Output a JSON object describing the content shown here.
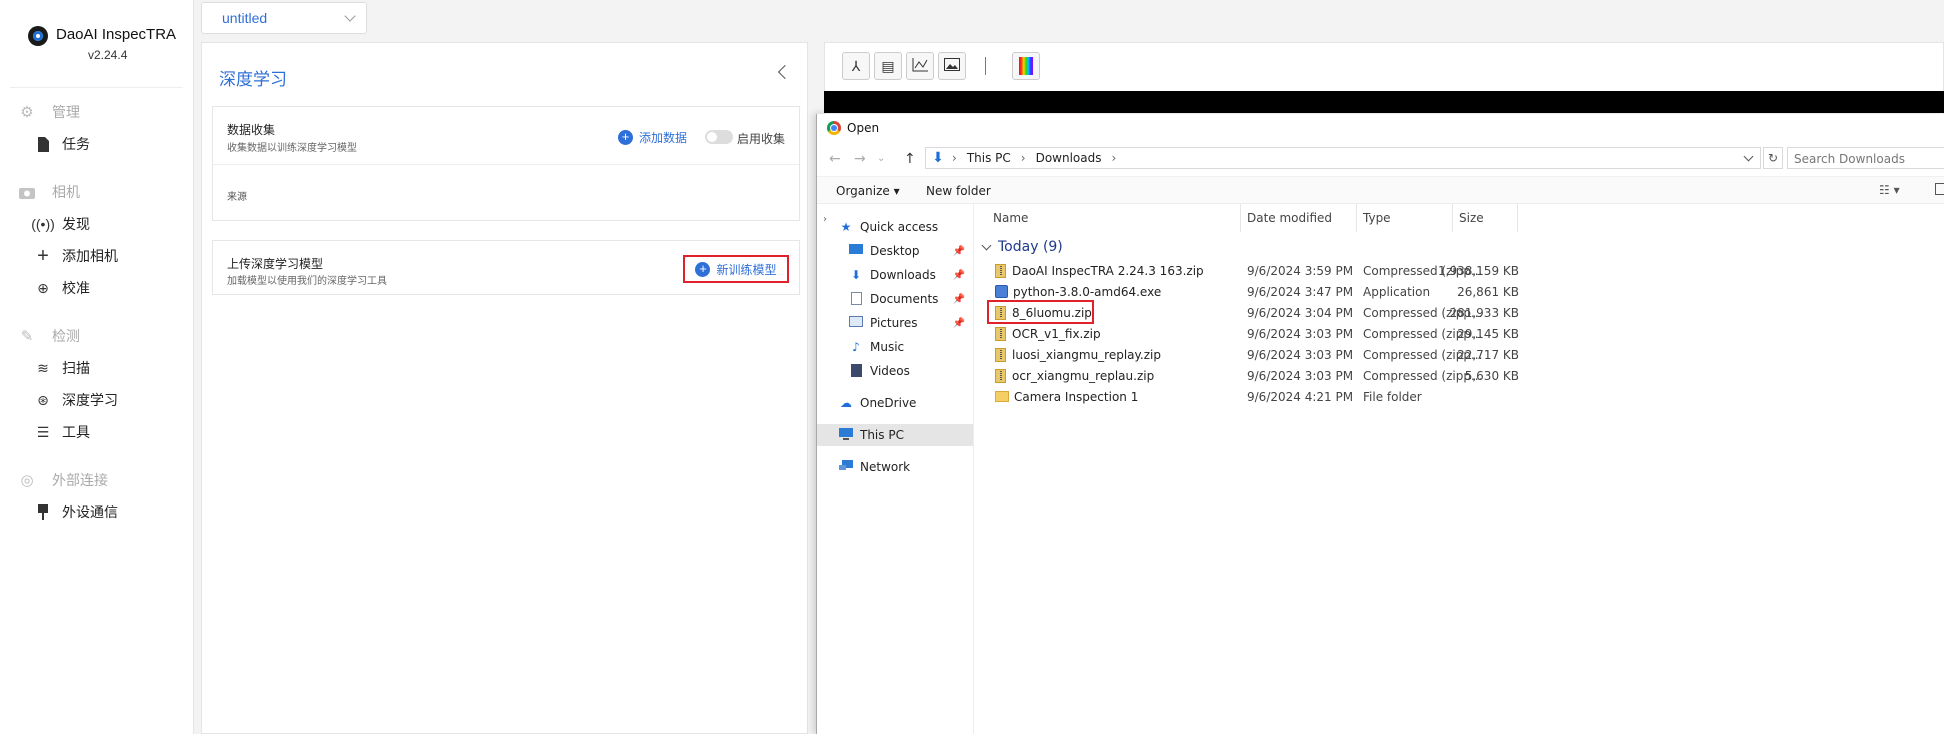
{
  "app": {
    "name": "DaoAI InspecTRA",
    "version": "v2.24.4",
    "project_select": "untitled"
  },
  "sidebar": {
    "groups": [
      {
        "label": "管理",
        "icon": "gear-icon",
        "items": [
          {
            "label": "任务",
            "icon": "document-icon"
          }
        ]
      },
      {
        "label": "相机",
        "icon": "camera-icon",
        "items": [
          {
            "label": "发现",
            "icon": "broadcast-icon"
          },
          {
            "label": "添加相机",
            "icon": "plus-icon"
          },
          {
            "label": "校准",
            "icon": "target-icon"
          }
        ]
      },
      {
        "label": "检测",
        "icon": "tools-icon",
        "items": [
          {
            "label": "扫描",
            "icon": "scan-icon"
          },
          {
            "label": "深度学习",
            "icon": "network-icon"
          },
          {
            "label": "工具",
            "icon": "sliders-icon"
          }
        ]
      },
      {
        "label": "外部连接",
        "icon": "link-icon",
        "items": [
          {
            "label": "外设通信",
            "icon": "plug-icon"
          }
        ]
      }
    ]
  },
  "panel": {
    "title": "深度学习",
    "data_collection": {
      "title": "数据收集",
      "subtitle": "收集数据以训练深度学习模型",
      "add_data_label": "添加数据",
      "toggle_label": "启用收集",
      "toggle_on": false,
      "source_label": "来源"
    },
    "upload_model": {
      "title": "上传深度学习模型",
      "subtitle": "加载模型以使用我们的深度学习工具",
      "new_model_label": "新训练模型"
    }
  },
  "viewer": {
    "tools": [
      "pose-icon",
      "list-icon",
      "chart-icon",
      "image-icon",
      "colormap-icon"
    ]
  },
  "dialog": {
    "title": "Open",
    "breadcrumb": [
      "This PC",
      "Downloads"
    ],
    "search_placeholder": "Search Downloads",
    "organize_label": "Organize ▾",
    "new_folder_label": "New folder",
    "nav": [
      {
        "label": "Quick access",
        "icon": "star-icon",
        "pinned": false,
        "selected": false
      },
      {
        "label": "Desktop",
        "icon": "desktop-icon",
        "pinned": true,
        "selected": false
      },
      {
        "label": "Downloads",
        "icon": "download-icon",
        "pinned": true,
        "selected": false
      },
      {
        "label": "Documents",
        "icon": "documents-icon",
        "pinned": true,
        "selected": false
      },
      {
        "label": "Pictures",
        "icon": "pictures-icon",
        "pinned": true,
        "selected": false
      },
      {
        "label": "Music",
        "icon": "music-icon",
        "pinned": false,
        "selected": false
      },
      {
        "label": "Videos",
        "icon": "videos-icon",
        "pinned": false,
        "selected": false
      },
      {
        "label": "OneDrive",
        "icon": "cloud-icon",
        "pinned": false,
        "selected": false
      },
      {
        "label": "This PC",
        "icon": "computer-icon",
        "pinned": false,
        "selected": true
      },
      {
        "label": "Network",
        "icon": "network-drive-icon",
        "pinned": false,
        "selected": false
      }
    ],
    "columns": [
      "Name",
      "Date modified",
      "Type",
      "Size"
    ],
    "group_label": "Today (9)",
    "files": [
      {
        "name": "DaoAI InspecTRA 2.24.3 163.zip",
        "date": "9/6/2024 3:59 PM",
        "type": "Compressed (zipp...",
        "size": "1,938,159 KB",
        "icon": "zip"
      },
      {
        "name": "python-3.8.0-amd64.exe",
        "date": "9/6/2024 3:47 PM",
        "type": "Application",
        "size": "26,861 KB",
        "icon": "exe"
      },
      {
        "name": "8_6luomu.zip",
        "date": "9/6/2024 3:04 PM",
        "type": "Compressed (zipp...",
        "size": "281,933 KB",
        "icon": "zip"
      },
      {
        "name": "OCR_v1_fix.zip",
        "date": "9/6/2024 3:03 PM",
        "type": "Compressed (zipp...",
        "size": "29,145 KB",
        "icon": "zip"
      },
      {
        "name": "luosi_xiangmu_replay.zip",
        "date": "9/6/2024 3:03 PM",
        "type": "Compressed (zipp...",
        "size": "22,717 KB",
        "icon": "zip"
      },
      {
        "name": "ocr_xiangmu_replau.zip",
        "date": "9/6/2024 3:03 PM",
        "type": "Compressed (zipp...",
        "size": "5,630 KB",
        "icon": "zip"
      },
      {
        "name": "Camera Inspection 1",
        "date": "9/6/2024 4:21 PM",
        "type": "File folder",
        "size": "",
        "icon": "folder"
      }
    ]
  },
  "colors": {
    "accent": "#2f6fd8",
    "highlight": "#e0202a"
  }
}
